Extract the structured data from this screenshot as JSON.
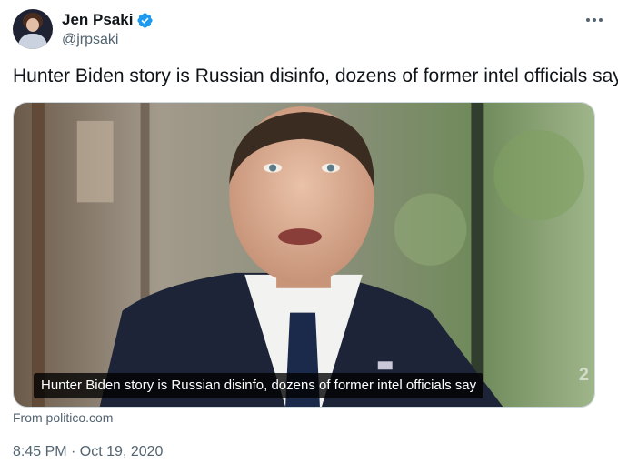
{
  "author": {
    "display_name": "Jen Psaki",
    "handle": "@jrpsaki",
    "verified": true,
    "avatar_icon": "profile-photo",
    "verified_icon": "verified-badge-icon",
    "verified_color": "#1d9bf0"
  },
  "tweet": {
    "text": "Hunter Biden story is Russian disinfo, dozens of former intel officials say",
    "media": {
      "caption": "Hunter Biden story is Russian disinfo, dozens of former intel officials say",
      "watermark": "2"
    },
    "source_link": "From politico.com",
    "timestamp": "8:45 PM · Oct 19, 2020"
  },
  "menu": {
    "icon": "more-options-icon"
  }
}
